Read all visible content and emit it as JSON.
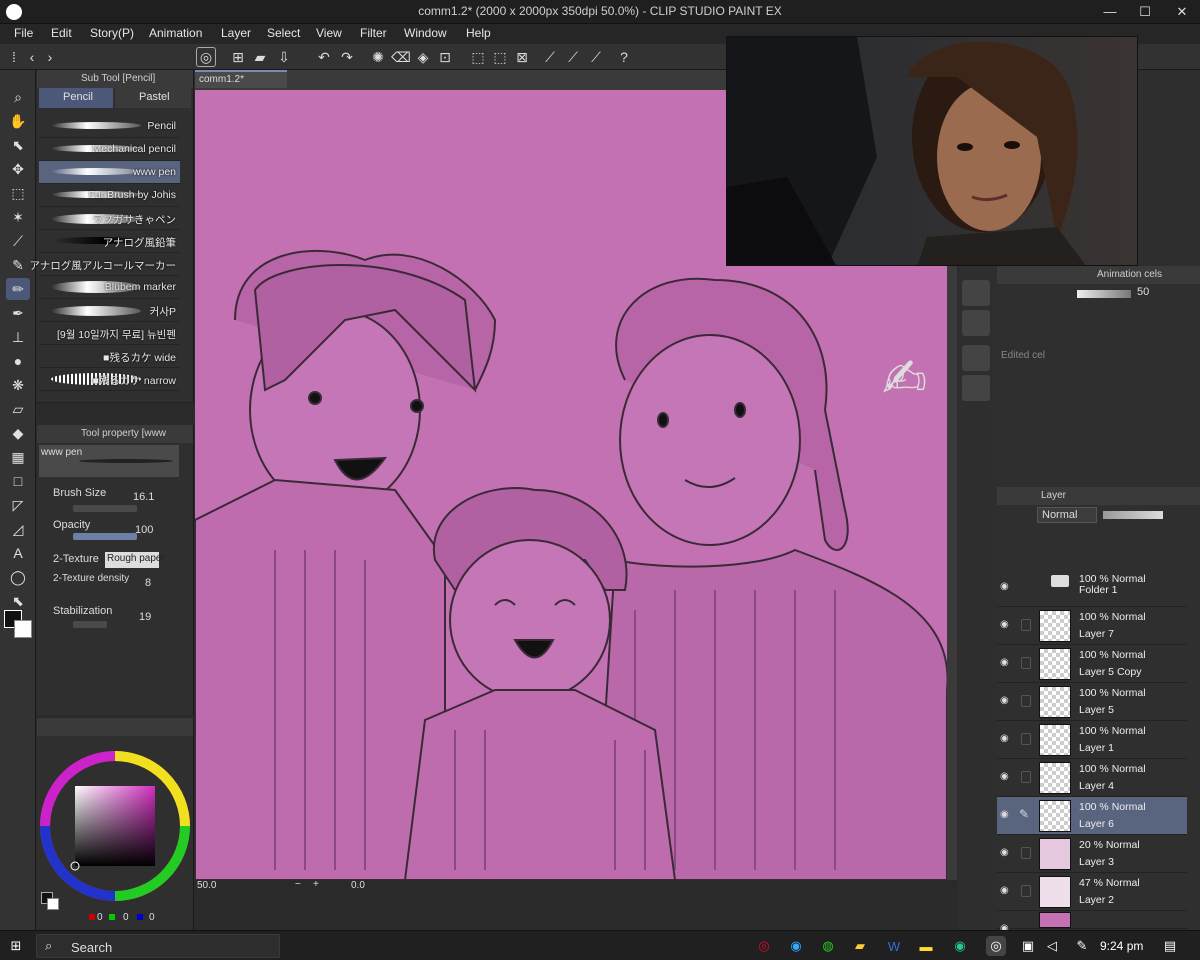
{
  "window": {
    "title": "comm1.2* (2000 x 2000px 350dpi 50.0%) - CLIP STUDIO PAINT EX",
    "minimize": "—",
    "maximize": "☐",
    "close": "✕"
  },
  "menu": [
    "File",
    "Edit",
    "Story(P)",
    "Animation",
    "Layer",
    "Select",
    "View",
    "Filter",
    "Window",
    "Help"
  ],
  "subtool": {
    "panel_title": "Sub Tool [Pencil]",
    "tabs": [
      "Pencil",
      "Pastel"
    ],
    "brushes": [
      "Pencil",
      "Mechanical pencil",
      "www pen",
      "Fur Brush by Johis",
      "ラフガサきゃペン",
      "アナログ風鉛筆",
      "アナログ風アルコールマーカー",
      "Blubem marker",
      "커사P",
      "[9월 10일까지 무료] 뉴빈펜",
      "■残るカケ wide",
      "■残るカケ narrow"
    ]
  },
  "toolprop": {
    "panel_title": "Tool property [www",
    "preview_name": "www pen",
    "brush_size_label": "Brush Size",
    "brush_size_value": "16.1",
    "opacity_label": "Opacity",
    "opacity_value": "100",
    "texture_label": "2-Texture",
    "texture_value": "Rough paper",
    "texture_density_label": "2-Texture density",
    "texture_density_value": "8",
    "stabilization_label": "Stabilization",
    "stabilization_value": "19"
  },
  "color": {
    "main": "#111111",
    "sub": "#ffffff",
    "rgb_values": [
      "0",
      "0",
      "0"
    ]
  },
  "canvas": {
    "tab": "comm1.2*",
    "bg_color": "#c371b3",
    "zoom": "50.0",
    "rotate": "0.0"
  },
  "animcels": {
    "title": "Animation cels",
    "opacity_value": "50",
    "edited_cel": "Edited cel"
  },
  "layers": {
    "title": "Layer",
    "blend": "Normal",
    "items": [
      {
        "mode": "100 % Normal",
        "name": "Folder 1",
        "folder": true
      },
      {
        "mode": "100 % Normal",
        "name": "Layer 7"
      },
      {
        "mode": "100 % Normal",
        "name": "Layer 5 Copy"
      },
      {
        "mode": "100 % Normal",
        "name": "Layer 5"
      },
      {
        "mode": "100 % Normal",
        "name": "Layer 1"
      },
      {
        "mode": "100 % Normal",
        "name": "Layer 4"
      },
      {
        "mode": "100 % Normal",
        "name": "Layer 6",
        "selected": true
      },
      {
        "mode": "20 % Normal",
        "name": "Layer 3"
      },
      {
        "mode": "47 % Normal",
        "name": "Layer 2"
      }
    ]
  },
  "taskbar": {
    "search": "Search",
    "time": "9:24 pm"
  }
}
